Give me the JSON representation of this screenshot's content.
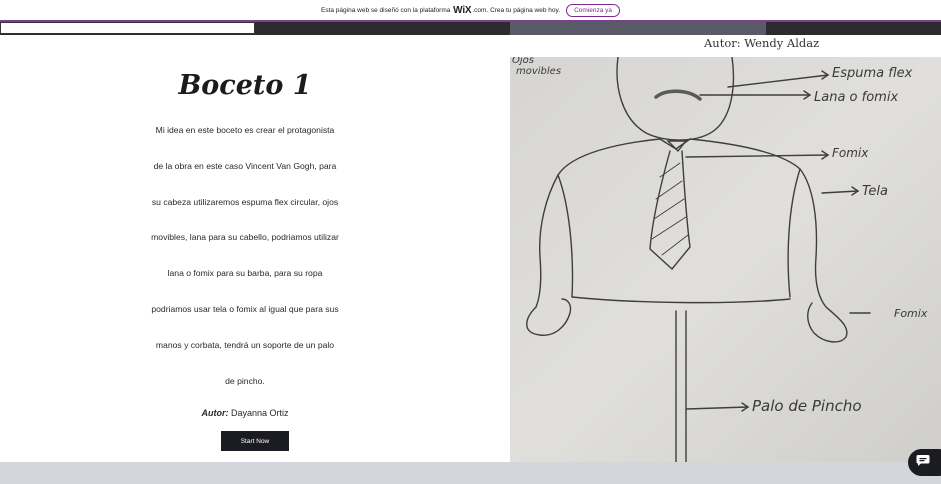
{
  "banner": {
    "text_before": "Esta página web se diseñó con la plataforma",
    "brand": "WiX",
    "text_after": ".com. Crea tu página web hoy.",
    "cta_label": "Comienza ya"
  },
  "hero": {
    "title": "Boceto 1",
    "paragraph_lines": [
      "Mi idea en este boceto es crear el protagonista",
      "de la obra en este caso Vincent Van Gogh, para",
      "su cabeza utilizaremos espuma flex circular, ojos",
      "movibles, lana para su cabello, podriamos utilizar",
      "lana o fomix para su barba, para su ropa",
      "podriamos usar tela o fomix al igual que para sus",
      "manos y corbata, tendrá un soporte de un palo",
      "de pincho."
    ],
    "author_label": "Autor:",
    "author_name": " Dayanna Ortiz",
    "button_label": "Start Now"
  },
  "sketch": {
    "author": "Autor: Wendy Aldaz",
    "labels": {
      "ojos": "Ojos",
      "movibles": "movibles",
      "espuma_flex": "Espuma flex",
      "lana_fomix": "Lana o fomix",
      "fomix_tie": "Fomix",
      "tela": "Tela",
      "fomix_hands": "Fomix",
      "palo": "Palo de Pincho"
    }
  },
  "colors": {
    "brand_purple": "#7b2a8e",
    "dark": "#1b1b22",
    "pencil": "#3e3e3e"
  },
  "icons": {
    "chat": "chat-bubble-icon"
  }
}
